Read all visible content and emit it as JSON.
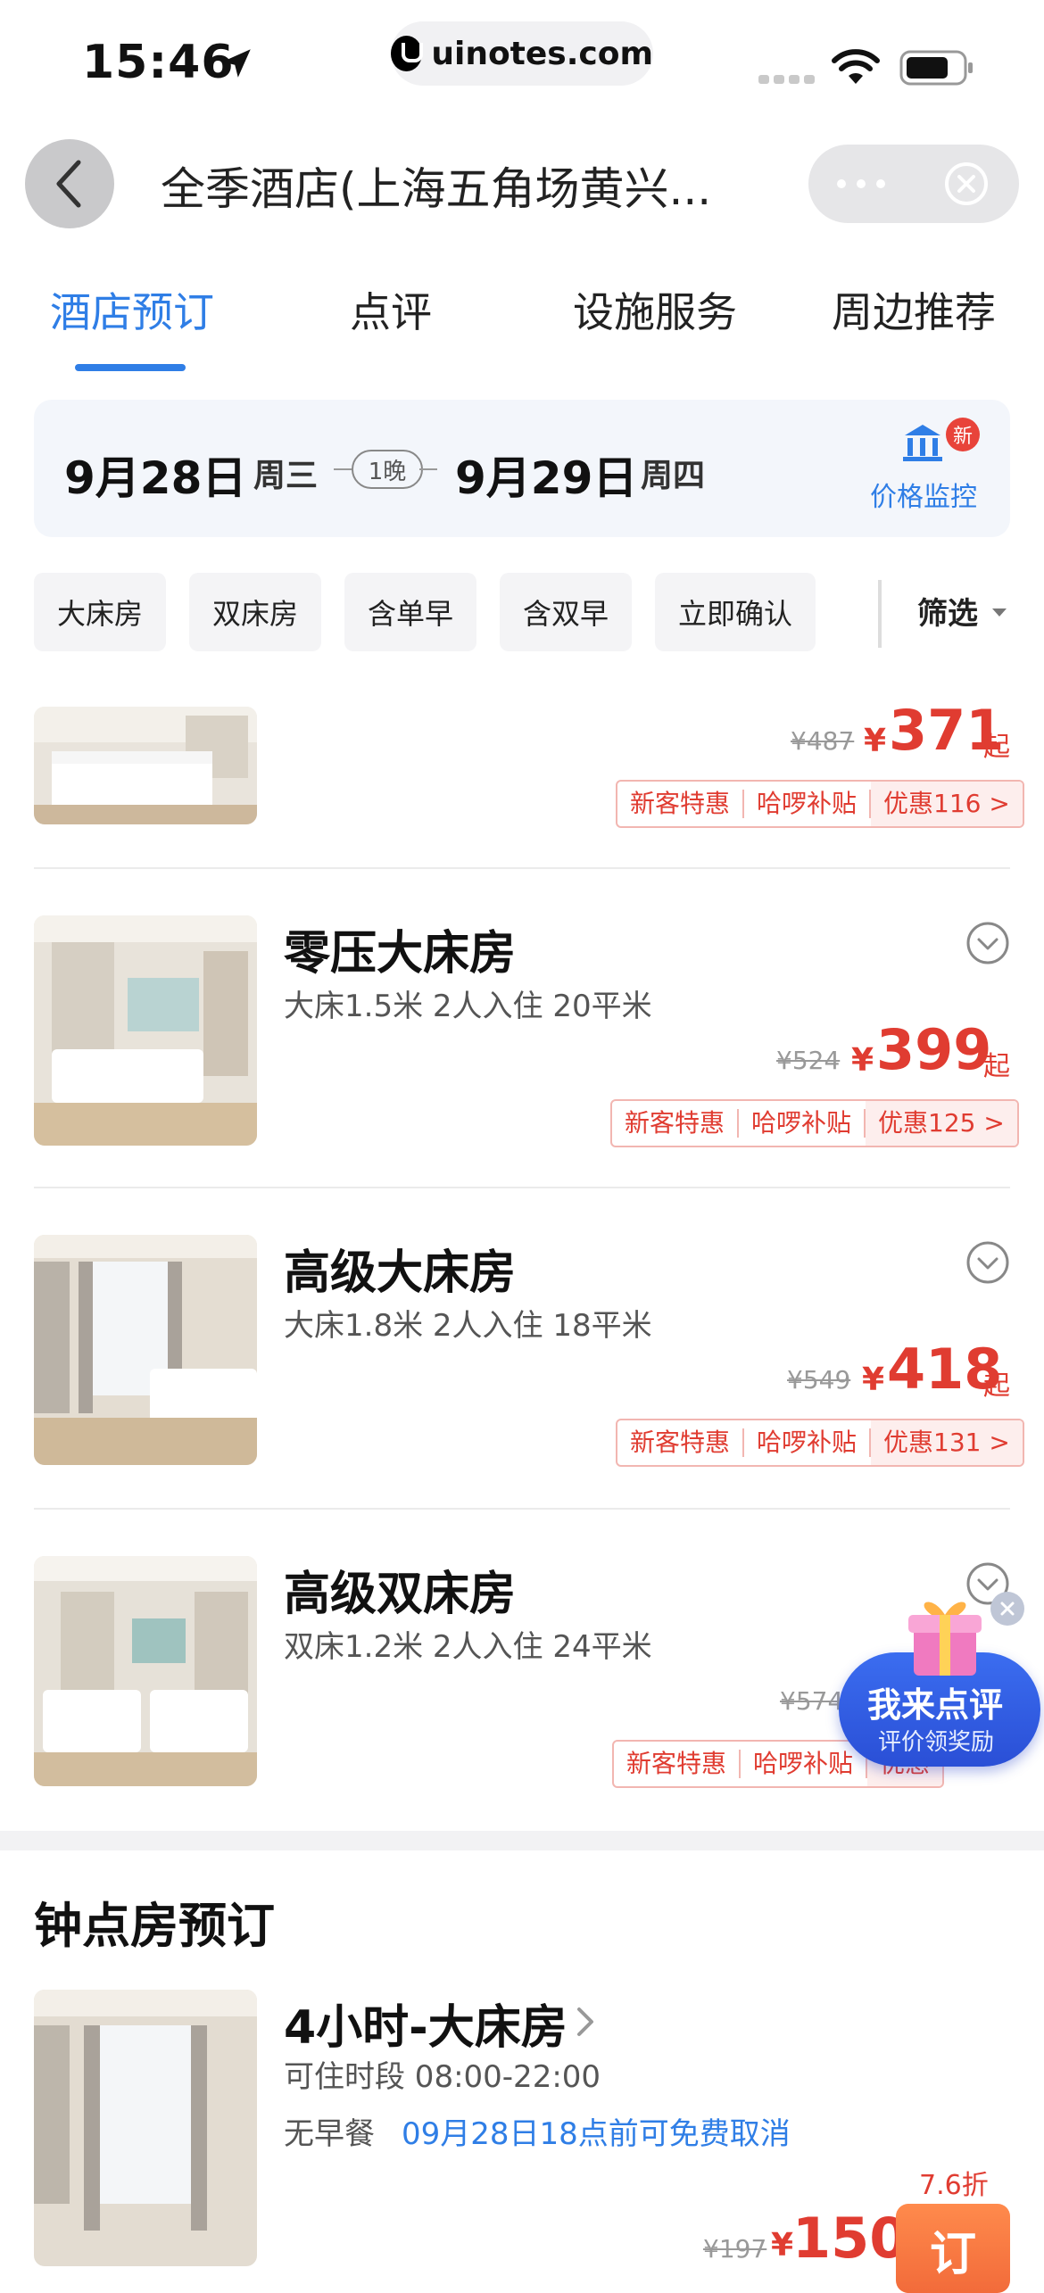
{
  "status_bar": {
    "time": "15:46",
    "url": "uinotes.com"
  },
  "nav": {
    "title": "全季酒店(上海五角场黄兴..."
  },
  "tabs": [
    {
      "label": "酒店预订",
      "active": true
    },
    {
      "label": "点评",
      "active": false
    },
    {
      "label": "设施服务",
      "active": false
    },
    {
      "label": "周边推荐",
      "active": false
    }
  ],
  "dates": {
    "checkin_date": "9月28日",
    "checkin_weekday": "周三",
    "nights": "1晚",
    "checkout_date": "9月29日",
    "checkout_weekday": "周四",
    "monitor_label": "价格监控",
    "new_badge": "新"
  },
  "filters": {
    "chips": [
      "大床房",
      "双床房",
      "含单早",
      "含双早",
      "立即确认"
    ],
    "filter_label": "筛选"
  },
  "rooms": [
    {
      "name": "",
      "desc": "",
      "orig_price": "¥487",
      "currency": "¥",
      "price": "371",
      "suffix": "起",
      "tags": [
        "新客特惠",
        "哈啰补贴",
        "优惠116 >"
      ]
    },
    {
      "name": "零压大床房",
      "desc": "大床1.5米 2人入住 20平米",
      "orig_price": "¥524",
      "currency": "¥",
      "price": "399",
      "suffix": "起",
      "tags": [
        "新客特惠",
        "哈啰补贴",
        "优惠125 >"
      ]
    },
    {
      "name": "高级大床房",
      "desc": "大床1.8米 2人入住 18平米",
      "orig_price": "¥549",
      "currency": "¥",
      "price": "418",
      "suffix": "起",
      "tags": [
        "新客特惠",
        "哈啰补贴",
        "优惠131 >"
      ]
    },
    {
      "name": "高级双床房",
      "desc": "双床1.2米 2人入住 24平米",
      "orig_price": "¥574",
      "currency": "¥",
      "price": "",
      "suffix": "",
      "tags": [
        "新客特惠",
        "哈啰补贴",
        "优惠"
      ]
    }
  ],
  "hourly": {
    "section_title": "钟点房预订",
    "name": "4小时-大床房",
    "period": "可住时段 08:00-22:00",
    "breakfast": "无早餐",
    "cancel": "09月28日18点前可免费取消",
    "discount": "7.6折",
    "orig_price": "¥197",
    "currency": "¥",
    "price": "150",
    "book_label": "订"
  },
  "review_widget": {
    "title": "我来点评",
    "subtitle": "评价领奖励"
  },
  "colors": {
    "accent_blue": "#2f7ee6",
    "price_red": "#e03c31",
    "book_orange": "#f26b3a"
  }
}
